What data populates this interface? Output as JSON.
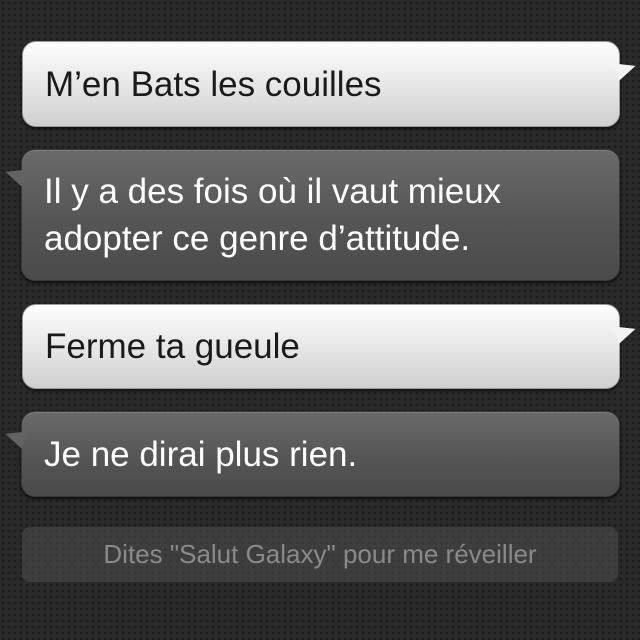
{
  "conversation": {
    "messages": [
      {
        "role": "user",
        "text": "M’en Bats les couilles"
      },
      {
        "role": "assistant",
        "text": "Il y a des fois où il vaut mieux\nadopter ce genre d’attitude."
      },
      {
        "role": "user",
        "text": "Ferme ta gueule"
      },
      {
        "role": "assistant",
        "text": "Je ne dirai plus rien."
      }
    ]
  },
  "hint": {
    "text": "Dites \"Salut Galaxy\" pour me réveiller"
  },
  "colors": {
    "user_bubble": "#e6e6e6",
    "assistant_bubble": "#555555",
    "background": "#2a2a2a",
    "hint_text": "#8a8a8a"
  }
}
